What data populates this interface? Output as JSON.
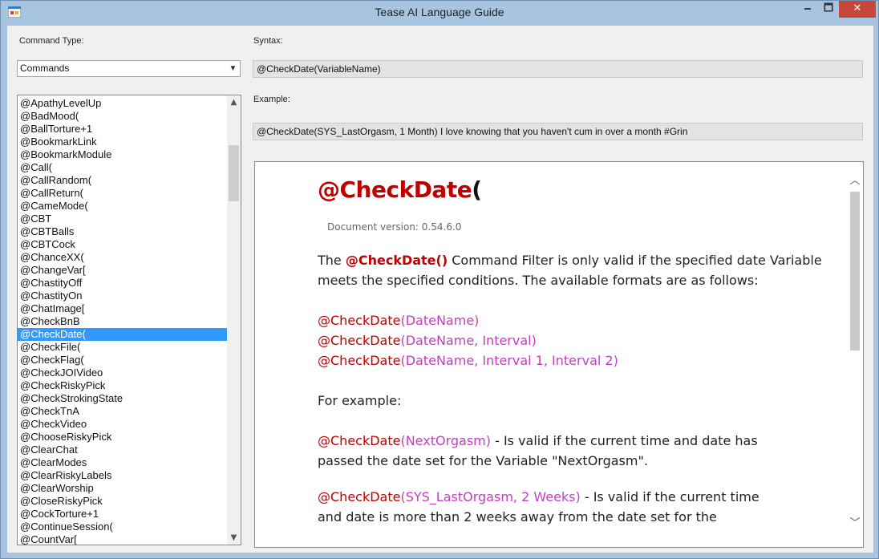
{
  "window": {
    "title": "Tease AI Language Guide",
    "minimize_glyph": "🗕",
    "maximize_glyph": "🗖",
    "close_glyph": "✕"
  },
  "command_type": {
    "label": "Command Type:",
    "selected": "Commands"
  },
  "syntax": {
    "label": "Syntax:",
    "value": "@CheckDate(VariableName)"
  },
  "example": {
    "label": "Example:",
    "value": "@CheckDate(SYS_LastOrgasm, 1 Month) I love knowing that you haven't cum in over a month #Grin"
  },
  "command_list": {
    "items": [
      "@ApathyLevelUp",
      "@BadMood(",
      "@BallTorture+1",
      "@BookmarkLink",
      "@BookmarkModule",
      "@Call(",
      "@CallRandom(",
      "@CallReturn(",
      "@CameMode(",
      "@CBT",
      "@CBTBalls",
      "@CBTCock",
      "@ChanceXX(",
      "@ChangeVar[",
      "@ChastityOff",
      "@ChastityOn",
      "@ChatImage[",
      "@CheckBnB",
      "@CheckDate(",
      "@CheckFile(",
      "@CheckFlag(",
      "@CheckJOIVideo",
      "@CheckRiskyPick",
      "@CheckStrokingState",
      "@CheckTnA",
      "@CheckVideo",
      "@ChooseRiskyPick",
      "@ClearChat",
      "@ClearModes",
      "@ClearRiskyLabels",
      "@ClearWorship",
      "@CloseRiskyPick",
      "@CockTorture+1",
      "@ContinueSession(",
      "@CountVar["
    ],
    "selected_index": 18
  },
  "doc": {
    "title_cmd": "@CheckDate",
    "title_paren": "(",
    "version": "Document version: 0.54.6.0",
    "intro_the": "The ",
    "intro_cmd": "@CheckDate()",
    "intro_rest": " Command Filter is only valid if the specified date Variable meets the specified conditions. The available formats are as follows:",
    "formats": [
      {
        "cmd": "@CheckDate",
        "args": "(DateName)"
      },
      {
        "cmd": "@CheckDate",
        "args": "(DateName, Interval)"
      },
      {
        "cmd": "@CheckDate",
        "args": "(DateName, Interval 1, Interval 2)"
      }
    ],
    "for_example": "For example:",
    "examples": [
      {
        "cmd": "@CheckDate",
        "args": "(NextOrgasm)",
        "desc": " - Is valid if the current time and date has passed the date set for the Variable \"NextOrgasm\"."
      },
      {
        "cmd": "@CheckDate",
        "args": "(SYS_LastOrgasm, 2 Weeks)",
        "desc": " - Is valid if the current time and date is more than 2 weeks away from the date set for the"
      }
    ]
  },
  "colors": {
    "command_red": "#c00000",
    "argument_magenta": "#c040c0",
    "selection_blue": "#3399ff",
    "close_button": "#c7463a"
  }
}
